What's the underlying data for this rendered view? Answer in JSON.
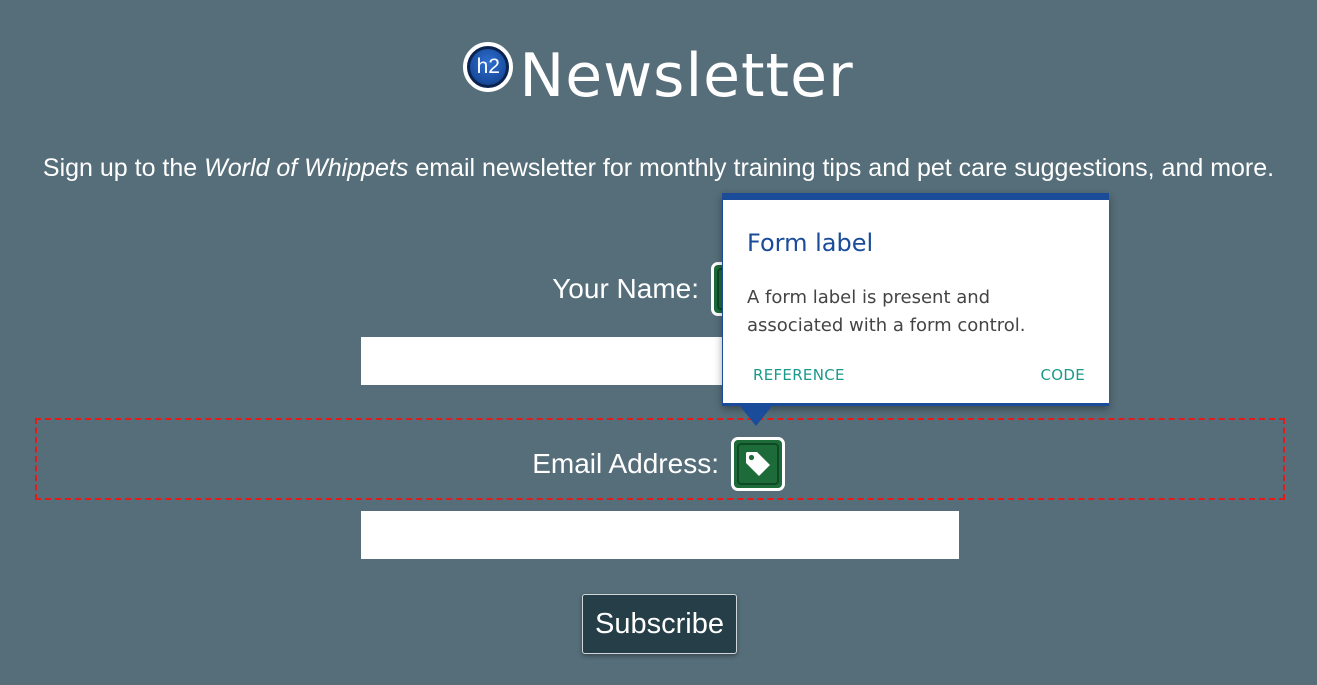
{
  "heading": {
    "badge_text": "h2",
    "title": "Newsletter"
  },
  "intro": {
    "prefix": "Sign up to the ",
    "emphasis": "World of Whippets",
    "suffix": " email newsletter for monthly training tips and pet care suggestions, and more."
  },
  "form": {
    "name_label": "Your Name:",
    "name_value": "",
    "email_label": "Email Address:",
    "email_value": "",
    "submit_label": "Subscribe"
  },
  "tooltip": {
    "title": "Form label",
    "body": "A form label is present and associated with a form control.",
    "reference_link": "REFERENCE",
    "code_link": "CODE"
  },
  "icons": {
    "heading_badge": "h2-heading-badge-icon",
    "label_tag": "tag-icon"
  },
  "colors": {
    "background": "#566e79",
    "tooltip_accent": "#1a4c9a",
    "link_color": "#1a9a8a",
    "tag_badge": "#1e6b3a",
    "focus_outline": "#e41b1b",
    "button_bg": "#253e47"
  }
}
